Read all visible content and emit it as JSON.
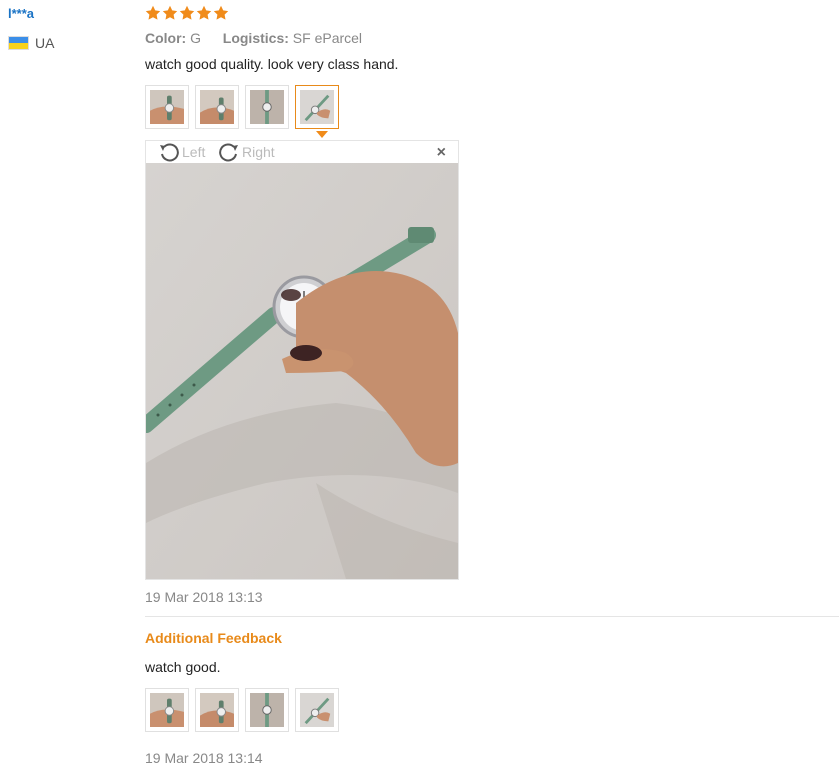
{
  "review": {
    "user": "l***a",
    "country_code": "UA",
    "rating": 5,
    "color_label": "Color:",
    "color_value": "G",
    "logistics_label": "Logistics:",
    "logistics_value": "SF eParcel",
    "text": "watch good quality. look very class hand.",
    "date": "19 Mar 2018 13:13"
  },
  "viewer": {
    "rotate_left_label": "Left",
    "rotate_right_label": "Right",
    "close_label": "×"
  },
  "additional": {
    "heading": "Additional Feedback",
    "text": "watch good.",
    "date": "19 Mar 2018 13:14"
  },
  "colors": {
    "username": "#1a73c5",
    "star": "#f08b1a",
    "accent": "#e88a1a",
    "strap": "#6e9a83"
  },
  "icons": [
    "star-icon",
    "ua-flag-icon",
    "rotate-left-icon",
    "rotate-right-icon",
    "close-icon"
  ]
}
